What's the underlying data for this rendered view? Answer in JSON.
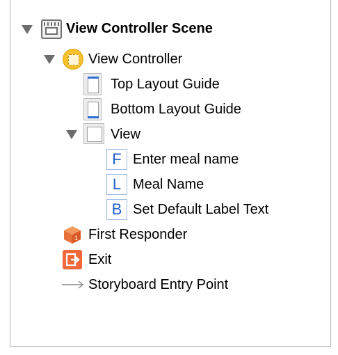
{
  "outline": {
    "scene": {
      "label": "View Controller Scene",
      "icon": "scene-icon"
    },
    "view_controller": {
      "label": "View Controller",
      "icon": "view-controller-icon"
    },
    "top_layout_guide": {
      "label": "Top Layout Guide",
      "icon": "top-layout-guide-icon"
    },
    "bottom_layout_guide": {
      "label": "Bottom Layout Guide",
      "icon": "bottom-layout-guide-icon"
    },
    "view": {
      "label": "View",
      "icon": "view-icon"
    },
    "text_field": {
      "label": "Enter meal name",
      "icon_letter": "F"
    },
    "label_item": {
      "label": "Meal Name",
      "icon_letter": "L"
    },
    "button_item": {
      "label": "Set Default Label Text",
      "icon_letter": "B"
    },
    "first_responder": {
      "label": "First Responder",
      "icon": "first-responder-icon"
    },
    "exit": {
      "label": "Exit",
      "icon": "exit-icon"
    },
    "entry_point": {
      "label": "Storyboard Entry Point",
      "icon": "arrow-icon"
    }
  },
  "colors": {
    "accent_blue": "#1f5fc8",
    "view_controller_yellow": "#f7c22b",
    "exit_orange": "#f0683a",
    "first_responder_orange": "#e8703a"
  }
}
